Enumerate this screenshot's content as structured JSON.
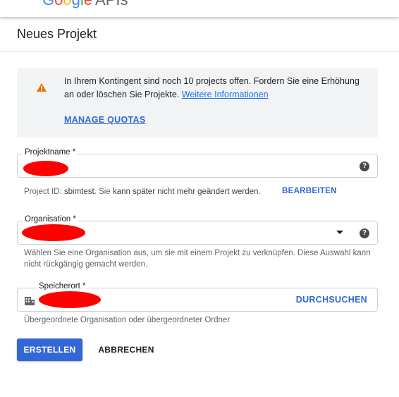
{
  "app": {
    "logo_letters": [
      "G",
      "o",
      "o",
      "g",
      "l",
      "e"
    ],
    "logo_suffix": "APIs"
  },
  "page": {
    "title": "Neues Projekt"
  },
  "quota": {
    "text_before_link": "In Ihrem Kontingent sind noch 10 projects offen. Fordern Sie eine Erhöhung an oder löschen Sie Projekte. ",
    "link_label": "Weitere Informationen",
    "manage_label": "MANAGE QUOTAS"
  },
  "project_name": {
    "label": "Projektname *",
    "value_redacted": true
  },
  "project_id": {
    "prefix": "Project ID: ",
    "id": "sbimtest",
    "suffix_plain": ". Sie ",
    "suffix_dark": "kann später nicht mehr geändert werden.",
    "edit_label": "BEARBEITEN"
  },
  "organisation": {
    "label": "Organisation *",
    "value_redacted": true,
    "hint": "Wählen Sie eine Organisation aus, um sie mit einem Projekt zu verknüpfen. Diese Auswahl kann nicht rückgängig gemacht werden."
  },
  "location": {
    "label": "Speicherort *",
    "value_redacted": true,
    "browse_label": "DURCHSUCHEN",
    "hint": "Übergeordnete Organisation oder übergeordneter Ordner"
  },
  "actions": {
    "create_label": "ERSTELLEN",
    "cancel_label": "ABBRECHEN"
  },
  "icons": {
    "menu": "hamburger-menu-icon",
    "warning": "warning-triangle-icon",
    "help": "question-mark-circle-icon",
    "dropdown": "dropdown-arrow-icon",
    "building": "building-icon"
  },
  "colors": {
    "accent": "#3367d6",
    "warning": "#e37400",
    "redaction": "#ff0000"
  }
}
